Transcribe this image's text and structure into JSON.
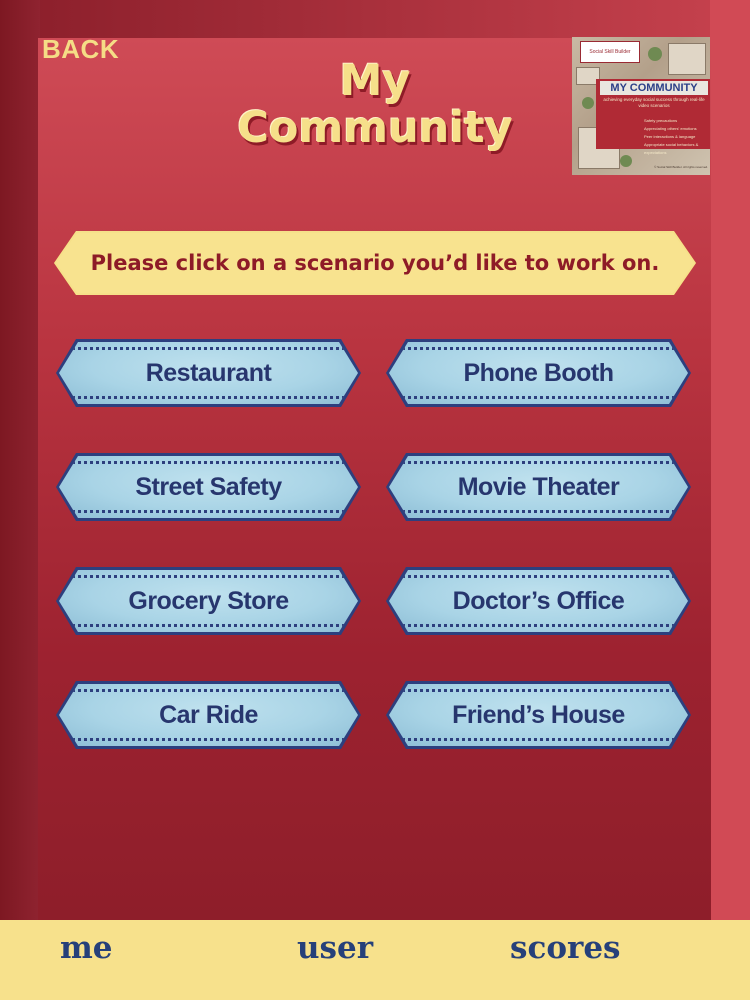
{
  "header": {
    "back_label": "BACK",
    "title_line1": "My",
    "title_line2": "Community"
  },
  "cover": {
    "logo_text": "Social Skill Builder",
    "title": "MY COMMUNITY",
    "subtitle": "achieving everyday social success through real-life video scenarios",
    "bullets": [
      "Safety precautions",
      "Appreciating others' emotions",
      "Peer interactions & language",
      "Appropriate social behaviors & expectations"
    ],
    "footer": "© Social Skill Builder. All rights reserved."
  },
  "instruction": "Please click on a scenario you’d like to work on.",
  "scenarios": [
    {
      "label": "Restaurant"
    },
    {
      "label": "Phone Booth"
    },
    {
      "label": "Street Safety"
    },
    {
      "label": "Movie Theater"
    },
    {
      "label": "Grocery Store"
    },
    {
      "label": "Doctor’s Office"
    },
    {
      "label": "Car Ride"
    },
    {
      "label": "Friend’s House"
    }
  ],
  "bottom_nav": [
    {
      "label": "me"
    },
    {
      "label": "user"
    },
    {
      "label": "scores"
    }
  ],
  "colors": {
    "panel_red": "#b93440",
    "gold": "#f6df8a",
    "button_blue": "#a9d4e6",
    "navy": "#27366e"
  }
}
